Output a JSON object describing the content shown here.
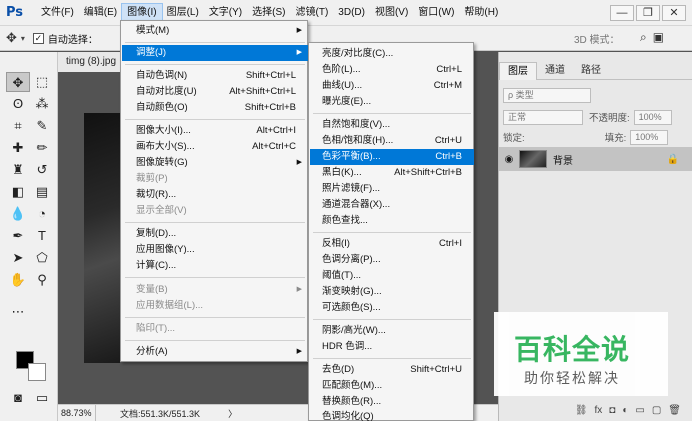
{
  "menubar": {
    "logo": "Ps",
    "items": [
      "文件(F)",
      "编辑(E)",
      "图像(I)",
      "图层(L)",
      "文字(Y)",
      "选择(S)",
      "滤镜(T)",
      "3D(D)",
      "视图(V)",
      "窗口(W)",
      "帮助(H)"
    ],
    "active_index": 2,
    "minimize": "—",
    "restore": "❐",
    "close": "✕"
  },
  "optionsbar": {
    "auto_select_check": "✓",
    "auto_select_label": "自动选择：",
    "mode_3d_label": "3D 模式："
  },
  "document": {
    "tab_title": "timg (8).jpg",
    "zoom": "88.73%",
    "doc_info": "文档:551.3K/551.3K",
    "status_arrow": "〉"
  },
  "image_menu": {
    "items": [
      {
        "label": "模式(M)",
        "submenu": true
      },
      {
        "label": "调整(J)",
        "submenu": true,
        "highlighted": true
      },
      {
        "label": "自动色调(N)",
        "shortcut": "Shift+Ctrl+L"
      },
      {
        "label": "自动对比度(U)",
        "shortcut": "Alt+Shift+Ctrl+L"
      },
      {
        "label": "自动颜色(O)",
        "shortcut": "Shift+Ctrl+B"
      },
      {
        "label": "图像大小(I)...",
        "shortcut": "Alt+Ctrl+I"
      },
      {
        "label": "画布大小(S)...",
        "shortcut": "Alt+Ctrl+C"
      },
      {
        "label": "图像旋转(G)",
        "submenu": true
      },
      {
        "label": "裁剪(P)",
        "disabled": true
      },
      {
        "label": "裁切(R)..."
      },
      {
        "label": "显示全部(V)",
        "disabled": true
      },
      {
        "label": "复制(D)..."
      },
      {
        "label": "应用图像(Y)..."
      },
      {
        "label": "计算(C)..."
      },
      {
        "label": "变量(B)",
        "submenu": true,
        "disabled": true
      },
      {
        "label": "应用数据组(L)...",
        "disabled": true
      },
      {
        "label": "陷印(T)...",
        "disabled": true
      },
      {
        "label": "分析(A)",
        "submenu": true
      }
    ]
  },
  "adjust_menu": {
    "items": [
      {
        "label": "亮度/对比度(C)..."
      },
      {
        "label": "色阶(L)...",
        "shortcut": "Ctrl+L"
      },
      {
        "label": "曲线(U)...",
        "shortcut": "Ctrl+M"
      },
      {
        "label": "曝光度(E)..."
      },
      {
        "label": "自然饱和度(V)..."
      },
      {
        "label": "色相/饱和度(H)...",
        "shortcut": "Ctrl+U"
      },
      {
        "label": "色彩平衡(B)...",
        "shortcut": "Ctrl+B",
        "highlighted": true
      },
      {
        "label": "黑白(K)...",
        "shortcut": "Alt+Shift+Ctrl+B"
      },
      {
        "label": "照片滤镜(F)..."
      },
      {
        "label": "通道混合器(X)..."
      },
      {
        "label": "颜色查找..."
      },
      {
        "label": "反相(I)",
        "shortcut": "Ctrl+I"
      },
      {
        "label": "色调分离(P)..."
      },
      {
        "label": "阈值(T)..."
      },
      {
        "label": "渐变映射(G)..."
      },
      {
        "label": "可选颜色(S)..."
      },
      {
        "label": "阴影/高光(W)..."
      },
      {
        "label": "HDR 色调..."
      },
      {
        "label": "去色(D)",
        "shortcut": "Shift+Ctrl+U"
      },
      {
        "label": "匹配颜色(M)..."
      },
      {
        "label": "替换颜色(R)..."
      },
      {
        "label": "色调均化(Q)"
      }
    ]
  },
  "layers_panel": {
    "tabs": [
      "图层",
      "通道",
      "路径"
    ],
    "filter_label": "ρ 类型",
    "blend_mode": "正常",
    "opacity_label": "不透明度:",
    "opacity_value": "100%",
    "lock_label": "锁定:",
    "fill_label": "填充:",
    "fill_value": "100%",
    "layer_name": "背景",
    "eye": "◉",
    "lock_icon": "🔒"
  },
  "watermark": {
    "title": "百科全说",
    "subtitle": "助你轻松解决"
  }
}
